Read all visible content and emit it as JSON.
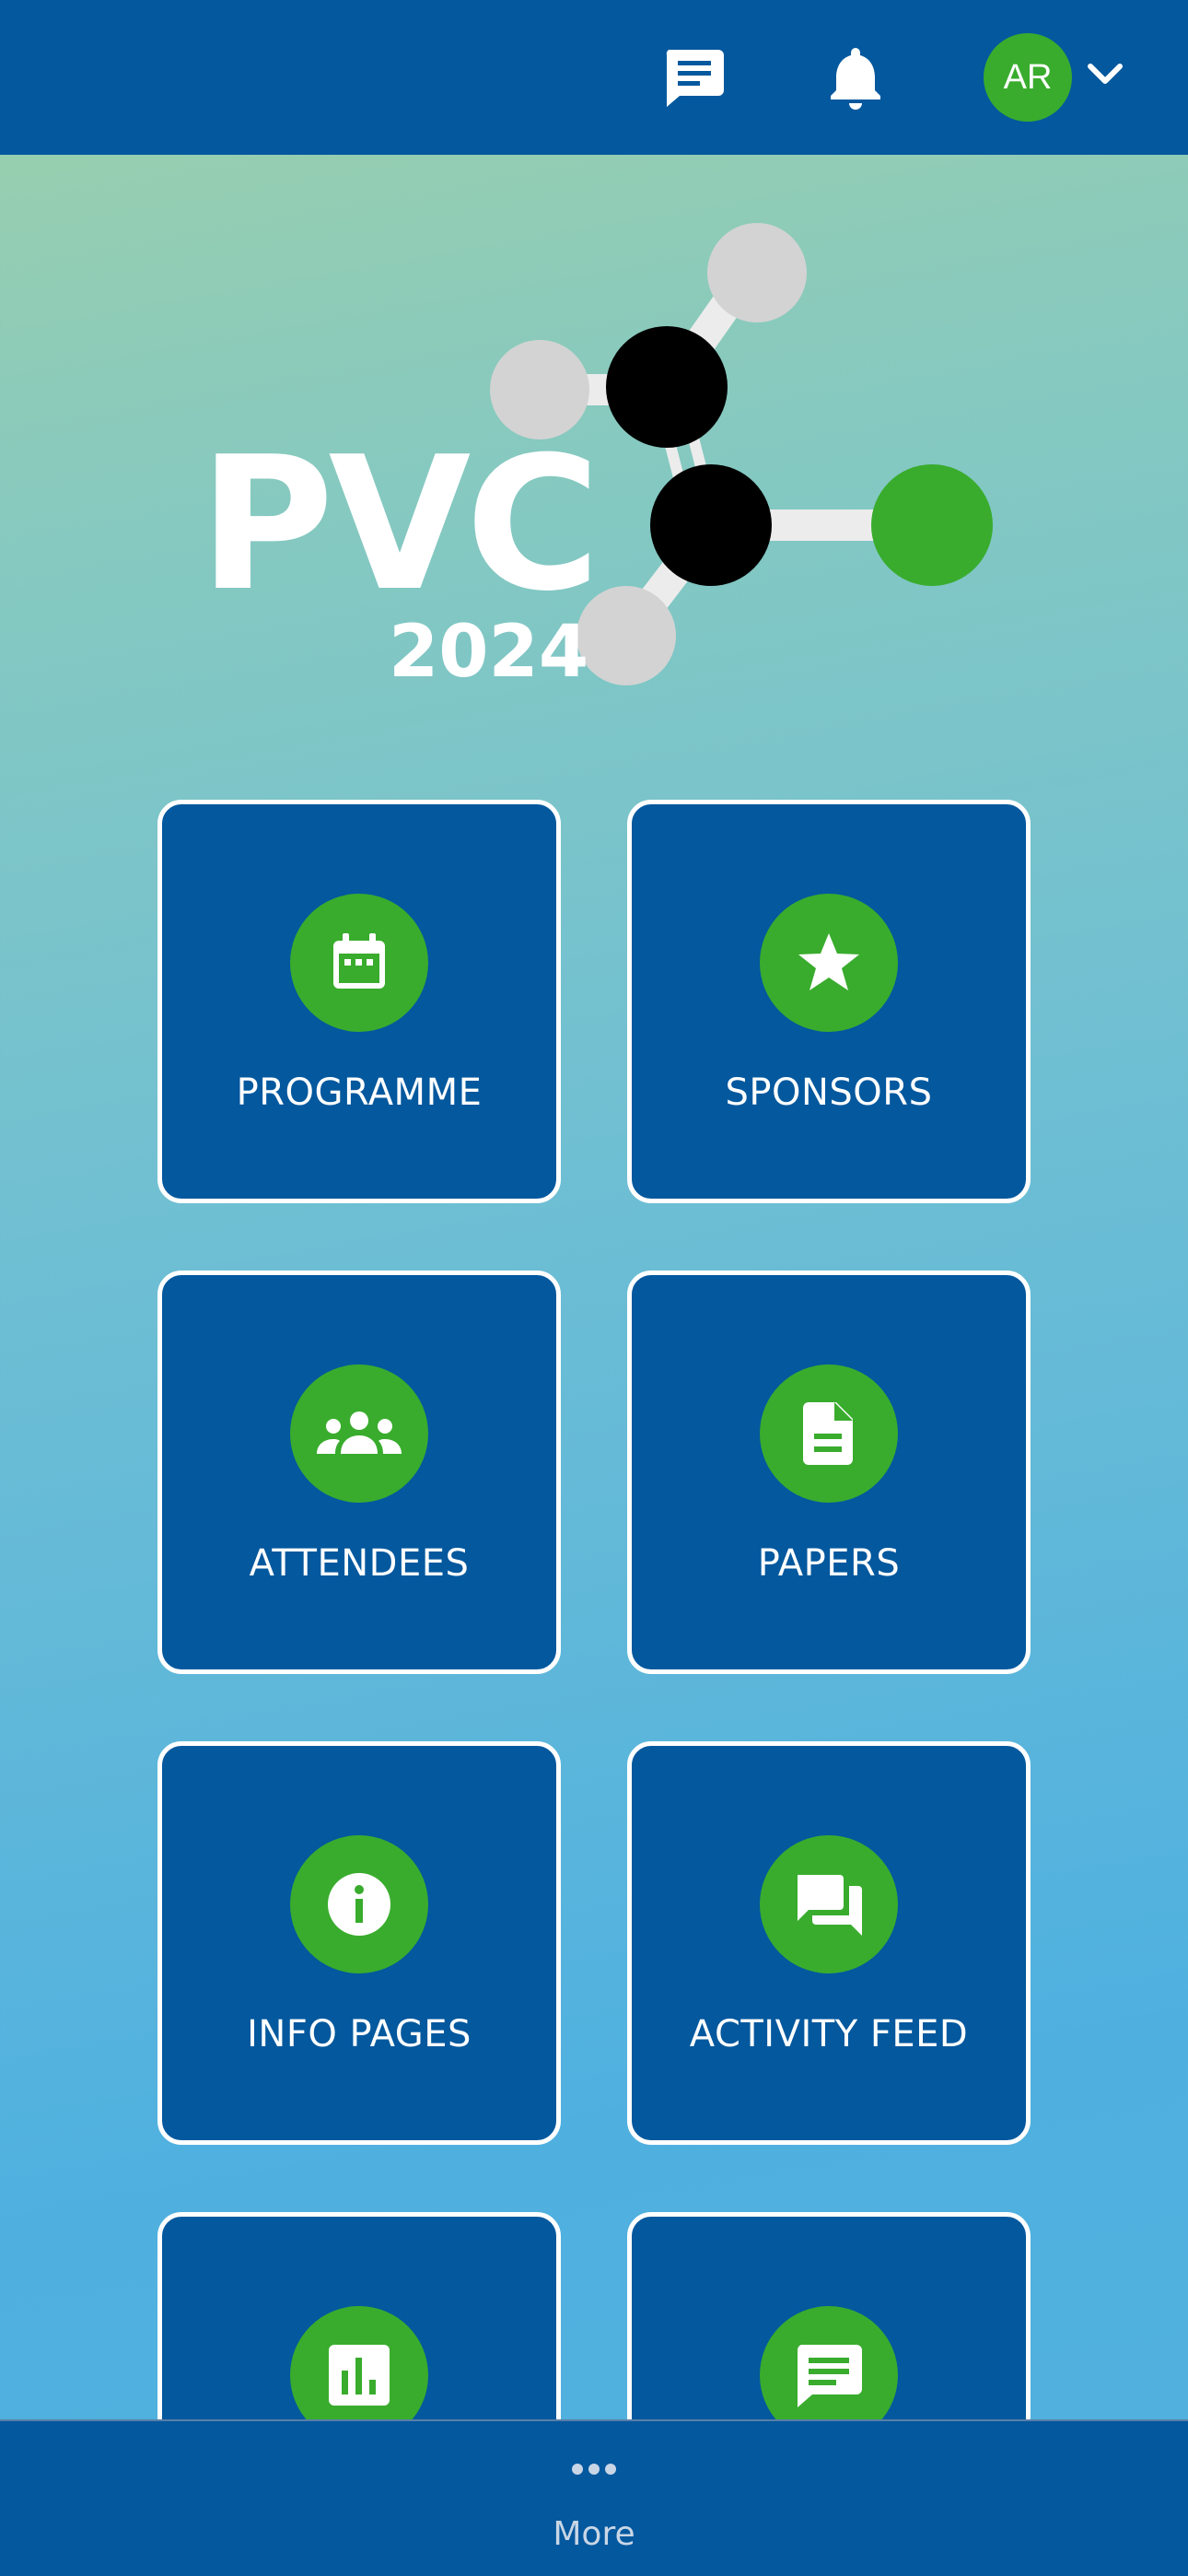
{
  "header": {
    "avatar_initials": "AR",
    "icons": [
      "chat-icon",
      "bell-icon",
      "chevron-down-icon"
    ]
  },
  "logo": {
    "title": "PVC",
    "year": "2024"
  },
  "tiles": [
    {
      "label": "PROGRAMME",
      "icon": "calendar-icon"
    },
    {
      "label": "SPONSORS",
      "icon": "star-icon"
    },
    {
      "label": "ATTENDEES",
      "icon": "people-icon"
    },
    {
      "label": "PAPERS",
      "icon": "document-icon"
    },
    {
      "label": "INFO PAGES",
      "icon": "info-icon"
    },
    {
      "label": "ACTIVITY FEED",
      "icon": "forum-icon"
    },
    {
      "label": "",
      "icon": "poll-icon"
    },
    {
      "label": "",
      "icon": "message-icon"
    }
  ],
  "bottom_nav": {
    "more_label": "More"
  },
  "colors": {
    "brand_blue": "#03589e",
    "accent_green": "#39ac2d",
    "white": "#ffffff"
  }
}
